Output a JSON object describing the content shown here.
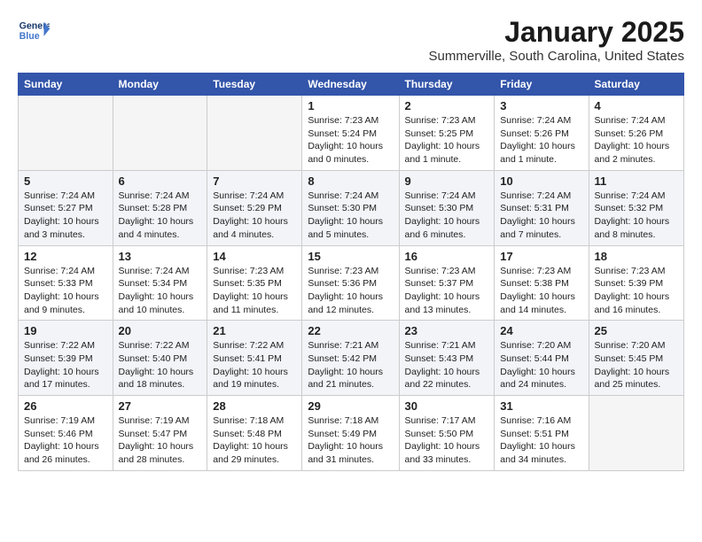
{
  "header": {
    "logo_line1": "General",
    "logo_line2": "Blue",
    "month_title": "January 2025",
    "location": "Summerville, South Carolina, United States"
  },
  "weekdays": [
    "Sunday",
    "Monday",
    "Tuesday",
    "Wednesday",
    "Thursday",
    "Friday",
    "Saturday"
  ],
  "weeks": [
    [
      {
        "day": "",
        "info": ""
      },
      {
        "day": "",
        "info": ""
      },
      {
        "day": "",
        "info": ""
      },
      {
        "day": "1",
        "info": "Sunrise: 7:23 AM\nSunset: 5:24 PM\nDaylight: 10 hours\nand 0 minutes."
      },
      {
        "day": "2",
        "info": "Sunrise: 7:23 AM\nSunset: 5:25 PM\nDaylight: 10 hours\nand 1 minute."
      },
      {
        "day": "3",
        "info": "Sunrise: 7:24 AM\nSunset: 5:26 PM\nDaylight: 10 hours\nand 1 minute."
      },
      {
        "day": "4",
        "info": "Sunrise: 7:24 AM\nSunset: 5:26 PM\nDaylight: 10 hours\nand 2 minutes."
      }
    ],
    [
      {
        "day": "5",
        "info": "Sunrise: 7:24 AM\nSunset: 5:27 PM\nDaylight: 10 hours\nand 3 minutes."
      },
      {
        "day": "6",
        "info": "Sunrise: 7:24 AM\nSunset: 5:28 PM\nDaylight: 10 hours\nand 4 minutes."
      },
      {
        "day": "7",
        "info": "Sunrise: 7:24 AM\nSunset: 5:29 PM\nDaylight: 10 hours\nand 4 minutes."
      },
      {
        "day": "8",
        "info": "Sunrise: 7:24 AM\nSunset: 5:30 PM\nDaylight: 10 hours\nand 5 minutes."
      },
      {
        "day": "9",
        "info": "Sunrise: 7:24 AM\nSunset: 5:30 PM\nDaylight: 10 hours\nand 6 minutes."
      },
      {
        "day": "10",
        "info": "Sunrise: 7:24 AM\nSunset: 5:31 PM\nDaylight: 10 hours\nand 7 minutes."
      },
      {
        "day": "11",
        "info": "Sunrise: 7:24 AM\nSunset: 5:32 PM\nDaylight: 10 hours\nand 8 minutes."
      }
    ],
    [
      {
        "day": "12",
        "info": "Sunrise: 7:24 AM\nSunset: 5:33 PM\nDaylight: 10 hours\nand 9 minutes."
      },
      {
        "day": "13",
        "info": "Sunrise: 7:24 AM\nSunset: 5:34 PM\nDaylight: 10 hours\nand 10 minutes."
      },
      {
        "day": "14",
        "info": "Sunrise: 7:23 AM\nSunset: 5:35 PM\nDaylight: 10 hours\nand 11 minutes."
      },
      {
        "day": "15",
        "info": "Sunrise: 7:23 AM\nSunset: 5:36 PM\nDaylight: 10 hours\nand 12 minutes."
      },
      {
        "day": "16",
        "info": "Sunrise: 7:23 AM\nSunset: 5:37 PM\nDaylight: 10 hours\nand 13 minutes."
      },
      {
        "day": "17",
        "info": "Sunrise: 7:23 AM\nSunset: 5:38 PM\nDaylight: 10 hours\nand 14 minutes."
      },
      {
        "day": "18",
        "info": "Sunrise: 7:23 AM\nSunset: 5:39 PM\nDaylight: 10 hours\nand 16 minutes."
      }
    ],
    [
      {
        "day": "19",
        "info": "Sunrise: 7:22 AM\nSunset: 5:39 PM\nDaylight: 10 hours\nand 17 minutes."
      },
      {
        "day": "20",
        "info": "Sunrise: 7:22 AM\nSunset: 5:40 PM\nDaylight: 10 hours\nand 18 minutes."
      },
      {
        "day": "21",
        "info": "Sunrise: 7:22 AM\nSunset: 5:41 PM\nDaylight: 10 hours\nand 19 minutes."
      },
      {
        "day": "22",
        "info": "Sunrise: 7:21 AM\nSunset: 5:42 PM\nDaylight: 10 hours\nand 21 minutes."
      },
      {
        "day": "23",
        "info": "Sunrise: 7:21 AM\nSunset: 5:43 PM\nDaylight: 10 hours\nand 22 minutes."
      },
      {
        "day": "24",
        "info": "Sunrise: 7:20 AM\nSunset: 5:44 PM\nDaylight: 10 hours\nand 24 minutes."
      },
      {
        "day": "25",
        "info": "Sunrise: 7:20 AM\nSunset: 5:45 PM\nDaylight: 10 hours\nand 25 minutes."
      }
    ],
    [
      {
        "day": "26",
        "info": "Sunrise: 7:19 AM\nSunset: 5:46 PM\nDaylight: 10 hours\nand 26 minutes."
      },
      {
        "day": "27",
        "info": "Sunrise: 7:19 AM\nSunset: 5:47 PM\nDaylight: 10 hours\nand 28 minutes."
      },
      {
        "day": "28",
        "info": "Sunrise: 7:18 AM\nSunset: 5:48 PM\nDaylight: 10 hours\nand 29 minutes."
      },
      {
        "day": "29",
        "info": "Sunrise: 7:18 AM\nSunset: 5:49 PM\nDaylight: 10 hours\nand 31 minutes."
      },
      {
        "day": "30",
        "info": "Sunrise: 7:17 AM\nSunset: 5:50 PM\nDaylight: 10 hours\nand 33 minutes."
      },
      {
        "day": "31",
        "info": "Sunrise: 7:16 AM\nSunset: 5:51 PM\nDaylight: 10 hours\nand 34 minutes."
      },
      {
        "day": "",
        "info": ""
      }
    ]
  ]
}
